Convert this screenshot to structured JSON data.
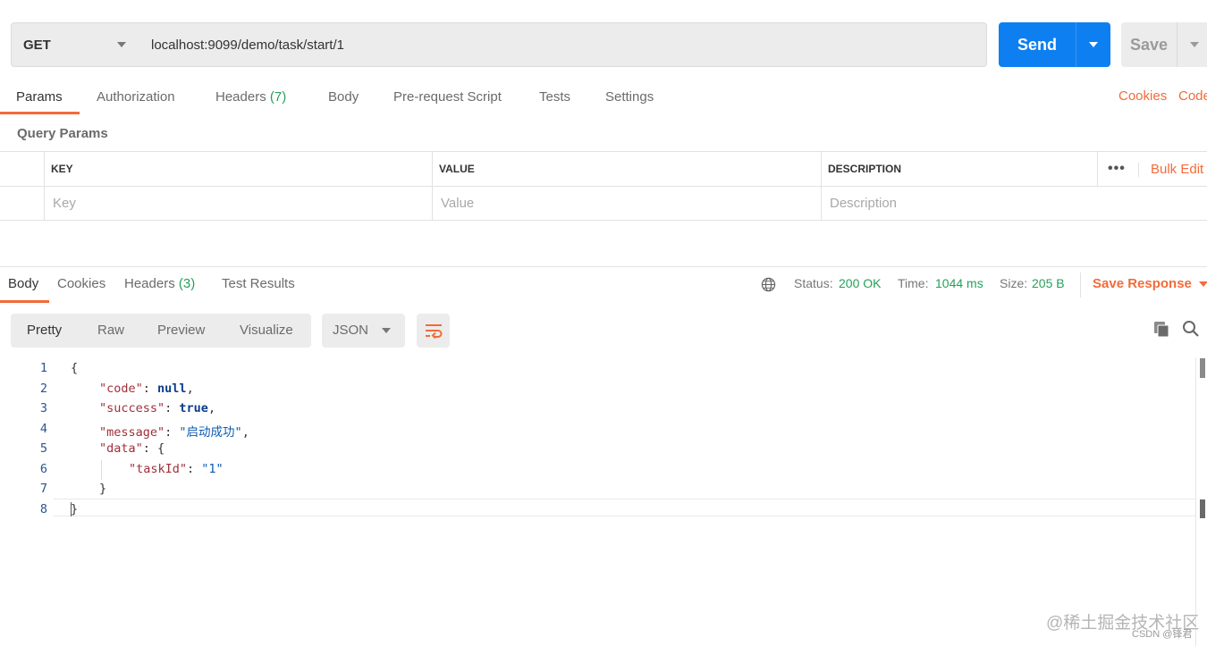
{
  "request": {
    "method": "GET",
    "url": "localhost:9099/demo/task/start/1",
    "send_label": "Send",
    "save_label": "Save"
  },
  "request_tabs": {
    "params": "Params",
    "authorization": "Authorization",
    "headers": "Headers",
    "headers_count": "(7)",
    "body": "Body",
    "prerequest": "Pre-request Script",
    "tests": "Tests",
    "settings": "Settings",
    "cookies": "Cookies",
    "code": "Code"
  },
  "query_params": {
    "title": "Query Params",
    "columns": {
      "key": "KEY",
      "value": "VALUE",
      "description": "DESCRIPTION"
    },
    "placeholders": {
      "key": "Key",
      "value": "Value",
      "description": "Description"
    },
    "more": "•••",
    "bulk_edit": "Bulk Edit"
  },
  "response_tabs": {
    "body": "Body",
    "cookies": "Cookies",
    "headers": "Headers",
    "headers_count": "(3)",
    "test_results": "Test Results"
  },
  "response_status": {
    "status_label": "Status:",
    "status_value": "200 OK",
    "time_label": "Time:",
    "time_value": "1044 ms",
    "size_label": "Size:",
    "size_value": "205 B",
    "save_response": "Save Response"
  },
  "view_tabs": {
    "pretty": "Pretty",
    "raw": "Raw",
    "preview": "Preview",
    "visualize": "Visualize",
    "format": "JSON"
  },
  "code_lines": {
    "n1": "1",
    "n2": "2",
    "n3": "3",
    "n4": "4",
    "n5": "5",
    "n6": "6",
    "n7": "7",
    "n8": "8",
    "open_brace": "{",
    "code_key": "\"code\"",
    "code_val": "null",
    "success_key": "\"success\"",
    "success_val": "true",
    "message_key": "\"message\"",
    "message_val": "\"启动成功\"",
    "data_key": "\"data\"",
    "data_open": "{",
    "taskid_key": "\"taskId\"",
    "taskid_val": "\"1\"",
    "data_close": "}",
    "close_brace": "}"
  },
  "watermark": {
    "main": "@稀土掘金技术社区",
    "sub": "CSDN @锋君"
  },
  "colors": {
    "accent": "#f26b3a",
    "send": "#0d7ff0",
    "success": "#26a05a"
  },
  "icons": [
    "caret-down-icon",
    "globe-icon",
    "wrap-lines-icon",
    "copy-icon",
    "search-icon"
  ]
}
